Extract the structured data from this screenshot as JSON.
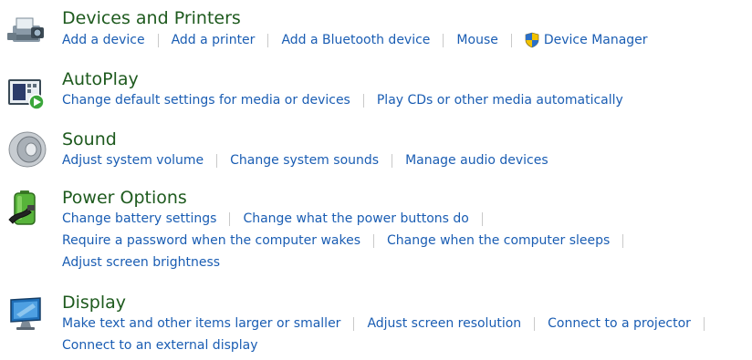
{
  "sections": [
    {
      "title": "Devices and Printers",
      "icon": "printer-camera-icon",
      "lines": [
        [
          "Add a device",
          "Add a printer",
          "Add a Bluetooth device",
          "Mouse",
          "Device Manager"
        ]
      ]
    },
    {
      "title": "AutoPlay",
      "icon": "autoplay-icon",
      "lines": [
        [
          "Change default settings for media or devices",
          "Play CDs or other media automatically"
        ]
      ]
    },
    {
      "title": "Sound",
      "icon": "speaker-icon",
      "lines": [
        [
          "Adjust system volume",
          "Change system sounds",
          "Manage audio devices"
        ]
      ]
    },
    {
      "title": "Power Options",
      "icon": "battery-plug-icon",
      "lines": [
        [
          "Change battery settings",
          "Change what the power buttons do"
        ],
        [
          "Require a password when the computer wakes",
          "Change when the computer sleeps"
        ],
        [
          "Adjust screen brightness"
        ]
      ]
    },
    {
      "title": "Display",
      "icon": "monitor-icon",
      "lines": [
        [
          "Make text and other items larger or smaller",
          "Adjust screen resolution",
          "Connect to a projector"
        ],
        [
          "Connect to an external display"
        ]
      ]
    }
  ],
  "colors": {
    "title": "#1e5a1e",
    "link": "#1a5db3",
    "separator": "#c9c9c9"
  }
}
